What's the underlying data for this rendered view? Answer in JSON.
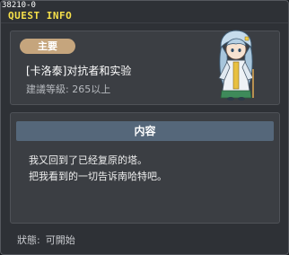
{
  "window": {
    "quest_id": "38210-0",
    "title": "QUEST INFO"
  },
  "quest": {
    "category": "主要",
    "name": "[卡洛泰]对抗者和实验",
    "level": "建議等級: 265以上"
  },
  "content": {
    "header": "内容",
    "lines": [
      "我又回到了已经复原的塔。",
      "把我看到的一切告诉南哈特吧。"
    ]
  },
  "status": {
    "label": "狀態:",
    "value": "可開始"
  },
  "colors": {
    "title": "#f6e04a",
    "badge": "#c5a57d",
    "content_header": "#55677a",
    "panel": "#3b3e43",
    "window": "#2e3136"
  },
  "icons": {
    "npc": "npc-portrait-icon"
  }
}
